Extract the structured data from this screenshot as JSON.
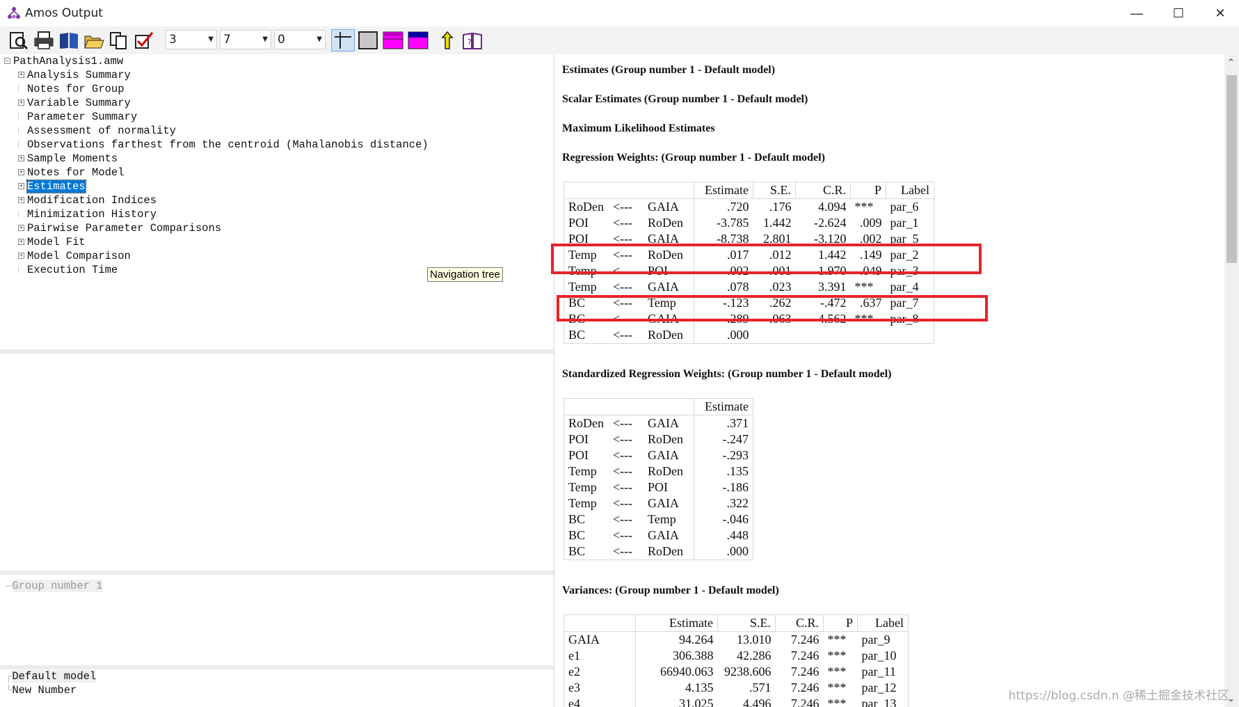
{
  "window": {
    "title": "Amos Output",
    "minimize": "—",
    "maximize": "☐",
    "close": "✕"
  },
  "toolbar": {
    "decimals": "3",
    "column_spacing": "7",
    "table_rows": "0",
    "icons": [
      "print-preview-icon",
      "print-icon",
      "book-icon",
      "open-folder-icon",
      "copy-icon",
      "checkmark-icon",
      "grid-lines-icon",
      "grid-gray-icon",
      "magenta-table-icon",
      "magenta-blue-table-icon",
      "tool-icon",
      "help-book-icon"
    ]
  },
  "tree": {
    "root": "PathAnalysis1.amw",
    "items": [
      {
        "label": "Analysis Summary",
        "expandable": true
      },
      {
        "label": "Notes for Group",
        "expandable": false
      },
      {
        "label": "Variable Summary",
        "expandable": true
      },
      {
        "label": "Parameter Summary",
        "expandable": false
      },
      {
        "label": "Assessment of normality",
        "expandable": false
      },
      {
        "label": "Observations farthest from the centroid (Mahalanobis distance)",
        "expandable": false
      },
      {
        "label": "Sample Moments",
        "expandable": true
      },
      {
        "label": "Notes for Model",
        "expandable": true
      },
      {
        "label": "Estimates",
        "expandable": true,
        "selected": true
      },
      {
        "label": "Modification Indices",
        "expandable": true
      },
      {
        "label": "Minimization History",
        "expandable": false
      },
      {
        "label": "Pairwise Parameter Comparisons",
        "expandable": true
      },
      {
        "label": "Model Fit",
        "expandable": true
      },
      {
        "label": "Model Comparison",
        "expandable": true
      },
      {
        "label": "Execution Time",
        "expandable": false
      }
    ],
    "tooltip": "Navigation tree"
  },
  "groups": {
    "item": "Group number 1"
  },
  "models": {
    "items": [
      "Default model",
      "New Number"
    ]
  },
  "output": {
    "h1": "Estimates (Group number 1 - Default model)",
    "h2": "Scalar Estimates (Group number 1 - Default model)",
    "h3": "Maximum Likelihood Estimates",
    "h4": "Regression Weights: (Group number 1 - Default model)",
    "reg_headers": [
      "",
      "",
      "",
      "Estimate",
      "S.E.",
      "C.R.",
      "P",
      "Label"
    ],
    "reg_rows": [
      [
        "RoDen",
        "<---",
        "GAIA",
        ".720",
        ".176",
        "4.094",
        "***",
        "par_6"
      ],
      [
        "POI",
        "<---",
        "RoDen",
        "-3.785",
        "1.442",
        "-2.624",
        ".009",
        "par_1"
      ],
      [
        "POI",
        "<---",
        "GAIA",
        "-8.738",
        "2.801",
        "-3.120",
        ".002",
        "par_5"
      ],
      [
        "Temp",
        "<---",
        "RoDen",
        ".017",
        ".012",
        "1.442",
        ".149",
        "par_2"
      ],
      [
        "Temp",
        "<---",
        "POI",
        "-.002",
        ".001",
        "-1.970",
        ".049",
        "par_3"
      ],
      [
        "Temp",
        "<---",
        "GAIA",
        ".078",
        ".023",
        "3.391",
        "***",
        "par_4"
      ],
      [
        "BC",
        "<---",
        "Temp",
        "-.123",
        ".262",
        "-.472",
        ".637",
        "par_7"
      ],
      [
        "BC",
        "<---",
        "GAIA",
        ".289",
        ".063",
        "4.562",
        "***",
        "par_8"
      ],
      [
        "BC",
        "<---",
        "RoDen",
        ".000",
        "",
        "",
        "",
        ""
      ]
    ],
    "h5": "Standardized Regression Weights: (Group number 1 - Default model)",
    "std_headers": [
      "",
      "",
      "",
      "Estimate"
    ],
    "std_rows": [
      [
        "RoDen",
        "<---",
        "GAIA",
        ".371"
      ],
      [
        "POI",
        "<---",
        "RoDen",
        "-.247"
      ],
      [
        "POI",
        "<---",
        "GAIA",
        "-.293"
      ],
      [
        "Temp",
        "<---",
        "RoDen",
        ".135"
      ],
      [
        "Temp",
        "<---",
        "POI",
        "-.186"
      ],
      [
        "Temp",
        "<---",
        "GAIA",
        ".322"
      ],
      [
        "BC",
        "<---",
        "Temp",
        "-.046"
      ],
      [
        "BC",
        "<---",
        "GAIA",
        ".448"
      ],
      [
        "BC",
        "<---",
        "RoDen",
        ".000"
      ]
    ],
    "h6": "Variances: (Group number 1 - Default model)",
    "var_headers": [
      "",
      "Estimate",
      "S.E.",
      "C.R.",
      "P",
      "Label"
    ],
    "var_rows": [
      [
        "GAIA",
        "94.264",
        "13.010",
        "7.246",
        "***",
        "par_9"
      ],
      [
        "e1",
        "306.388",
        "42.286",
        "7.246",
        "***",
        "par_10"
      ],
      [
        "e2",
        "66940.063",
        "9238.606",
        "7.246",
        "***",
        "par_11"
      ],
      [
        "e3",
        "4.135",
        ".571",
        "7.246",
        "***",
        "par_12"
      ],
      [
        "e4",
        "31.025",
        "4.496",
        "7.246",
        "***",
        "par_13"
      ]
    ]
  },
  "watermark": "https://blog.csdn.n @稀土掘金技术社区",
  "colors": {
    "highlight": "#e8232b",
    "selection": "#0078d7"
  }
}
